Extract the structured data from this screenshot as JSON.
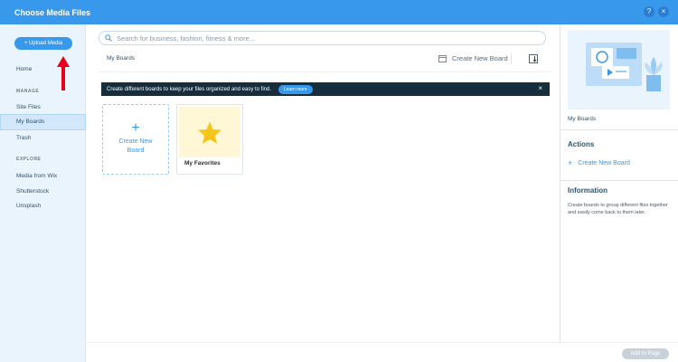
{
  "window": {
    "title": "Choose Media Files",
    "help_icon": "?",
    "close_icon": "×"
  },
  "sidebar": {
    "upload_label": "+ Upload Media",
    "home": "Home",
    "manage_heading": "MANAGE",
    "manage_items": [
      "Site Files",
      "My Boards",
      "Trash"
    ],
    "explore_heading": "EXPLORE",
    "explore_items": [
      "Media from Wix",
      "Shutterstock",
      "Unsplash"
    ]
  },
  "main": {
    "search_placeholder": "Search for business, fashion, fitness & more...",
    "breadcrumb": "My Boards",
    "create_new_board": "Create New Board",
    "banner_text": "Create different boards to keep your files organized and easy to find.",
    "learn_more": "Learn more",
    "banner_close": "×",
    "card_new_plus": "+",
    "card_new_label": "Create New Board",
    "card_fav_label": "My Favorites"
  },
  "right_panel": {
    "selected_label": "My Boards",
    "actions_heading": "Actions",
    "create_plus": "+",
    "create_label": "Create New Board",
    "info_heading": "Information",
    "info_text": "Create boards to group different files together and easily come back to them later."
  },
  "footer": {
    "add_to_page": "Add to Page"
  },
  "colors": {
    "accent": "#3899ec",
    "banner": "#162d3d",
    "annotation_arrow": "#e8001c",
    "star": "#f5c518"
  }
}
